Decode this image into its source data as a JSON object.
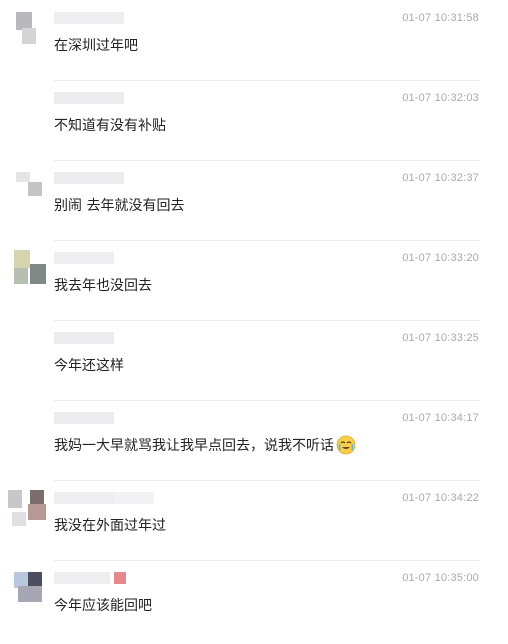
{
  "messages": [
    {
      "time": "01-07 10:31:58",
      "text": "在深圳过年吧"
    },
    {
      "time": "01-07 10:32:03",
      "text": "不知道有没有补贴"
    },
    {
      "time": "01-07 10:32:37",
      "text": "别闹 去年就没有回去"
    },
    {
      "time": "01-07 10:33:20",
      "text": "我去年也没回去"
    },
    {
      "time": "01-07 10:33:25",
      "text": "今年还这样"
    },
    {
      "time": "01-07 10:34:17",
      "text": "我妈一大早就骂我让我早点回去，说我不听话",
      "emoji": "crying-laughing-emoji"
    },
    {
      "time": "01-07 10:34:22",
      "text": "我没在外面过年过"
    },
    {
      "time": "01-07 10:35:00",
      "text": "今年应该能回吧"
    }
  ]
}
